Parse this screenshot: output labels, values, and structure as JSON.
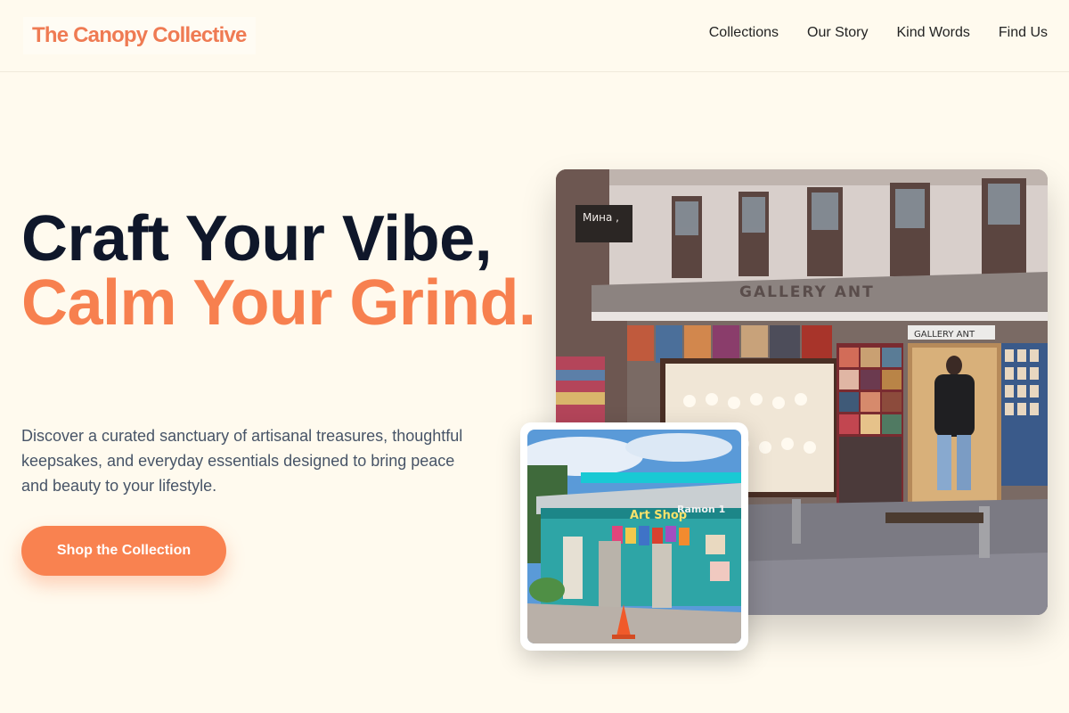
{
  "brand": {
    "name": "The Canopy Collective"
  },
  "nav": {
    "items": [
      {
        "label": "Collections"
      },
      {
        "label": "Our Story"
      },
      {
        "label": "Kind Words"
      },
      {
        "label": "Find Us"
      }
    ]
  },
  "hero": {
    "title_line1": "Craft Your Vibe,",
    "title_line2": "Calm Your Grind.",
    "subtitle": "Discover a curated sanctuary of artisanal treasures, thoughtful keepsakes, and everyday essentials designed to bring peace and beauty to your lifestyle.",
    "cta_label": "Shop the Collection"
  },
  "images": {
    "main": {
      "sign_text": "GALLERY ANT",
      "small_sign": "GALLERY ANT",
      "corner_sign": "Мина ,"
    },
    "inset": {
      "sign_text": "Art Shop",
      "sign2": "Ramon 1"
    }
  },
  "colors": {
    "accent": "#f7804f",
    "heading": "#0f172a",
    "background": "#fffaee",
    "body_text": "#475467"
  }
}
